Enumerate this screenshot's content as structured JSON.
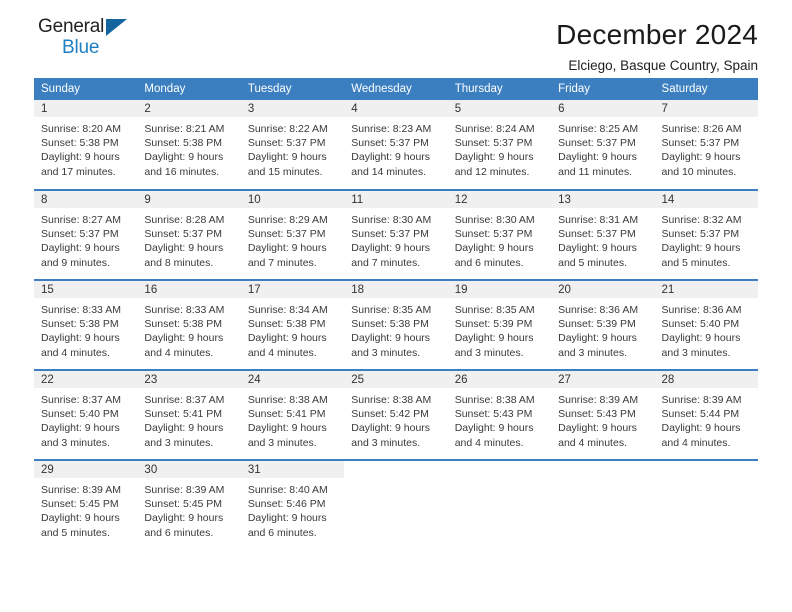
{
  "brand": {
    "name_top": "General",
    "name_bottom": "Blue",
    "accent_color": "#1f7fc4",
    "triangle_color": "#1464a0"
  },
  "header": {
    "title": "December 2024",
    "subtitle": "Elciego, Basque Country, Spain"
  },
  "calendar": {
    "header_bg": "#3c7fc0",
    "daynum_bg": "#f0f0f0",
    "weekdays": [
      "Sunday",
      "Monday",
      "Tuesday",
      "Wednesday",
      "Thursday",
      "Friday",
      "Saturday"
    ],
    "weeks": [
      [
        {
          "day": "1",
          "sunrise": "Sunrise: 8:20 AM",
          "sunset": "Sunset: 5:38 PM",
          "daylight1": "Daylight: 9 hours",
          "daylight2": "and 17 minutes."
        },
        {
          "day": "2",
          "sunrise": "Sunrise: 8:21 AM",
          "sunset": "Sunset: 5:38 PM",
          "daylight1": "Daylight: 9 hours",
          "daylight2": "and 16 minutes."
        },
        {
          "day": "3",
          "sunrise": "Sunrise: 8:22 AM",
          "sunset": "Sunset: 5:37 PM",
          "daylight1": "Daylight: 9 hours",
          "daylight2": "and 15 minutes."
        },
        {
          "day": "4",
          "sunrise": "Sunrise: 8:23 AM",
          "sunset": "Sunset: 5:37 PM",
          "daylight1": "Daylight: 9 hours",
          "daylight2": "and 14 minutes."
        },
        {
          "day": "5",
          "sunrise": "Sunrise: 8:24 AM",
          "sunset": "Sunset: 5:37 PM",
          "daylight1": "Daylight: 9 hours",
          "daylight2": "and 12 minutes."
        },
        {
          "day": "6",
          "sunrise": "Sunrise: 8:25 AM",
          "sunset": "Sunset: 5:37 PM",
          "daylight1": "Daylight: 9 hours",
          "daylight2": "and 11 minutes."
        },
        {
          "day": "7",
          "sunrise": "Sunrise: 8:26 AM",
          "sunset": "Sunset: 5:37 PM",
          "daylight1": "Daylight: 9 hours",
          "daylight2": "and 10 minutes."
        }
      ],
      [
        {
          "day": "8",
          "sunrise": "Sunrise: 8:27 AM",
          "sunset": "Sunset: 5:37 PM",
          "daylight1": "Daylight: 9 hours",
          "daylight2": "and 9 minutes."
        },
        {
          "day": "9",
          "sunrise": "Sunrise: 8:28 AM",
          "sunset": "Sunset: 5:37 PM",
          "daylight1": "Daylight: 9 hours",
          "daylight2": "and 8 minutes."
        },
        {
          "day": "10",
          "sunrise": "Sunrise: 8:29 AM",
          "sunset": "Sunset: 5:37 PM",
          "daylight1": "Daylight: 9 hours",
          "daylight2": "and 7 minutes."
        },
        {
          "day": "11",
          "sunrise": "Sunrise: 8:30 AM",
          "sunset": "Sunset: 5:37 PM",
          "daylight1": "Daylight: 9 hours",
          "daylight2": "and 7 minutes."
        },
        {
          "day": "12",
          "sunrise": "Sunrise: 8:30 AM",
          "sunset": "Sunset: 5:37 PM",
          "daylight1": "Daylight: 9 hours",
          "daylight2": "and 6 minutes."
        },
        {
          "day": "13",
          "sunrise": "Sunrise: 8:31 AM",
          "sunset": "Sunset: 5:37 PM",
          "daylight1": "Daylight: 9 hours",
          "daylight2": "and 5 minutes."
        },
        {
          "day": "14",
          "sunrise": "Sunrise: 8:32 AM",
          "sunset": "Sunset: 5:37 PM",
          "daylight1": "Daylight: 9 hours",
          "daylight2": "and 5 minutes."
        }
      ],
      [
        {
          "day": "15",
          "sunrise": "Sunrise: 8:33 AM",
          "sunset": "Sunset: 5:38 PM",
          "daylight1": "Daylight: 9 hours",
          "daylight2": "and 4 minutes."
        },
        {
          "day": "16",
          "sunrise": "Sunrise: 8:33 AM",
          "sunset": "Sunset: 5:38 PM",
          "daylight1": "Daylight: 9 hours",
          "daylight2": "and 4 minutes."
        },
        {
          "day": "17",
          "sunrise": "Sunrise: 8:34 AM",
          "sunset": "Sunset: 5:38 PM",
          "daylight1": "Daylight: 9 hours",
          "daylight2": "and 4 minutes."
        },
        {
          "day": "18",
          "sunrise": "Sunrise: 8:35 AM",
          "sunset": "Sunset: 5:38 PM",
          "daylight1": "Daylight: 9 hours",
          "daylight2": "and 3 minutes."
        },
        {
          "day": "19",
          "sunrise": "Sunrise: 8:35 AM",
          "sunset": "Sunset: 5:39 PM",
          "daylight1": "Daylight: 9 hours",
          "daylight2": "and 3 minutes."
        },
        {
          "day": "20",
          "sunrise": "Sunrise: 8:36 AM",
          "sunset": "Sunset: 5:39 PM",
          "daylight1": "Daylight: 9 hours",
          "daylight2": "and 3 minutes."
        },
        {
          "day": "21",
          "sunrise": "Sunrise: 8:36 AM",
          "sunset": "Sunset: 5:40 PM",
          "daylight1": "Daylight: 9 hours",
          "daylight2": "and 3 minutes."
        }
      ],
      [
        {
          "day": "22",
          "sunrise": "Sunrise: 8:37 AM",
          "sunset": "Sunset: 5:40 PM",
          "daylight1": "Daylight: 9 hours",
          "daylight2": "and 3 minutes."
        },
        {
          "day": "23",
          "sunrise": "Sunrise: 8:37 AM",
          "sunset": "Sunset: 5:41 PM",
          "daylight1": "Daylight: 9 hours",
          "daylight2": "and 3 minutes."
        },
        {
          "day": "24",
          "sunrise": "Sunrise: 8:38 AM",
          "sunset": "Sunset: 5:41 PM",
          "daylight1": "Daylight: 9 hours",
          "daylight2": "and 3 minutes."
        },
        {
          "day": "25",
          "sunrise": "Sunrise: 8:38 AM",
          "sunset": "Sunset: 5:42 PM",
          "daylight1": "Daylight: 9 hours",
          "daylight2": "and 3 minutes."
        },
        {
          "day": "26",
          "sunrise": "Sunrise: 8:38 AM",
          "sunset": "Sunset: 5:43 PM",
          "daylight1": "Daylight: 9 hours",
          "daylight2": "and 4 minutes."
        },
        {
          "day": "27",
          "sunrise": "Sunrise: 8:39 AM",
          "sunset": "Sunset: 5:43 PM",
          "daylight1": "Daylight: 9 hours",
          "daylight2": "and 4 minutes."
        },
        {
          "day": "28",
          "sunrise": "Sunrise: 8:39 AM",
          "sunset": "Sunset: 5:44 PM",
          "daylight1": "Daylight: 9 hours",
          "daylight2": "and 4 minutes."
        }
      ],
      [
        {
          "day": "29",
          "sunrise": "Sunrise: 8:39 AM",
          "sunset": "Sunset: 5:45 PM",
          "daylight1": "Daylight: 9 hours",
          "daylight2": "and 5 minutes."
        },
        {
          "day": "30",
          "sunrise": "Sunrise: 8:39 AM",
          "sunset": "Sunset: 5:45 PM",
          "daylight1": "Daylight: 9 hours",
          "daylight2": "and 6 minutes."
        },
        {
          "day": "31",
          "sunrise": "Sunrise: 8:40 AM",
          "sunset": "Sunset: 5:46 PM",
          "daylight1": "Daylight: 9 hours",
          "daylight2": "and 6 minutes."
        },
        {
          "day": "",
          "sunrise": "",
          "sunset": "",
          "daylight1": "",
          "daylight2": ""
        },
        {
          "day": "",
          "sunrise": "",
          "sunset": "",
          "daylight1": "",
          "daylight2": ""
        },
        {
          "day": "",
          "sunrise": "",
          "sunset": "",
          "daylight1": "",
          "daylight2": ""
        },
        {
          "day": "",
          "sunrise": "",
          "sunset": "",
          "daylight1": "",
          "daylight2": ""
        }
      ]
    ]
  }
}
